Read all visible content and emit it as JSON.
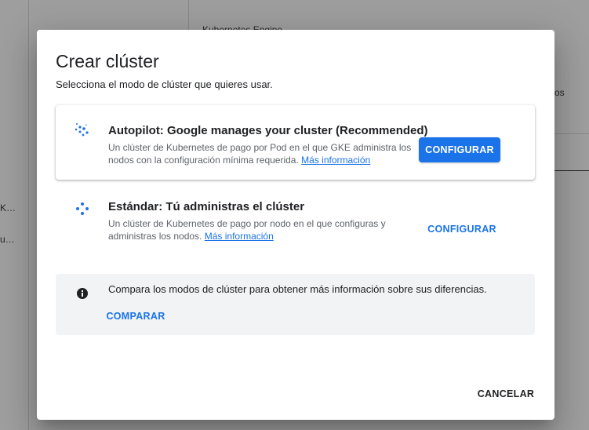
{
  "background": {
    "breadcrumb": "Kubernetes Engine",
    "side_item_1": "K…",
    "side_item_2": "u…",
    "right_text": "os"
  },
  "dialog": {
    "title": "Crear clúster",
    "subtitle": "Selecciona el modo de clúster que quieres usar.",
    "autopilot": {
      "icon": "autopilot-sparkle-icon",
      "title": "Autopilot: Google manages your cluster (Recommended)",
      "description": "Un clúster de Kubernetes de pago por Pod en el que GKE administra los nodos con la configuración mínima requerida.",
      "link": "Más información",
      "button": "CONFIGURAR"
    },
    "standard": {
      "icon": "standard-dots-icon",
      "title": "Estándar: Tú administras el clúster",
      "description": "Un clúster de Kubernetes de pago por nodo en el que configuras y administras los nodos.",
      "link": "Más información",
      "button": "CONFIGURAR"
    },
    "info": {
      "icon": "info-icon",
      "text": "Compara los modos de clúster para obtener más información sobre sus diferencias.",
      "button": "COMPARAR"
    },
    "cancel": "CANCELAR"
  },
  "colors": {
    "accent": "#1a73e8",
    "scrim": "rgba(0,0,0,0.38)",
    "info_bg": "#f1f3f4"
  }
}
